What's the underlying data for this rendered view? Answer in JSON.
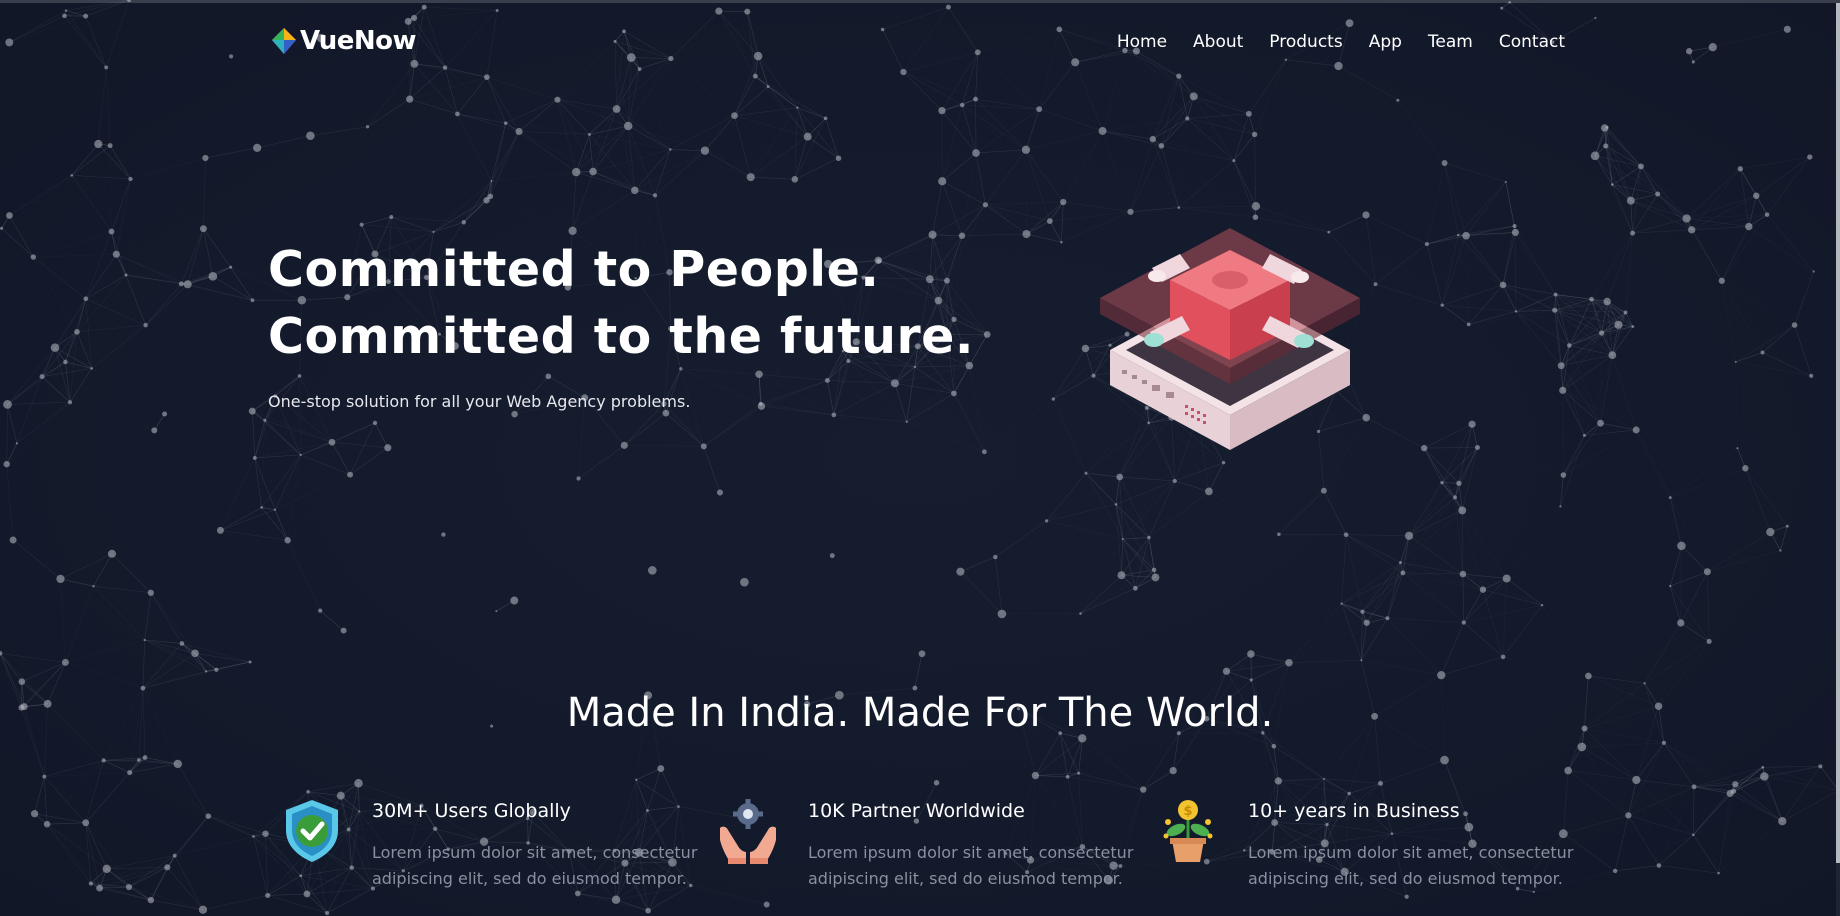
{
  "brand": {
    "name": "VueNow",
    "logo_icon": "diamond-logo-icon"
  },
  "nav": {
    "items": [
      {
        "label": "Home"
      },
      {
        "label": "About"
      },
      {
        "label": "Products"
      },
      {
        "label": "App"
      },
      {
        "label": "Team"
      },
      {
        "label": "Contact"
      }
    ]
  },
  "hero": {
    "title_line1": "Committed to People.",
    "title_line2": "Committed to the future.",
    "subtitle": "One-stop solution for all your Web Agency problems.",
    "illustration_icon": "isometric-server-icon"
  },
  "section": {
    "title": "Made In India. Made For The World."
  },
  "features": [
    {
      "icon": "shield-check-icon",
      "title": "30M+ Users Globally",
      "text": "Lorem ipsum dolor sit amet, consectetur adipiscing elit, sed do eiusmod tempor."
    },
    {
      "icon": "hands-gear-icon",
      "title": "10K Partner Worldwide",
      "text": "Lorem ipsum dolor sit amet, consectetur adipiscing elit, sed do eiusmod tempor."
    },
    {
      "icon": "money-plant-icon",
      "title": "10+ years in Business",
      "text": "Lorem ipsum dolor sit amet, consectetur adipiscing elit, sed do eiusmod tempor."
    }
  ],
  "colors": {
    "background": "#141a2a",
    "text": "#ffffff",
    "muted_text": "#8a90a0",
    "network_lines": "#9aa0ae",
    "accent_red": "#e8606a"
  }
}
